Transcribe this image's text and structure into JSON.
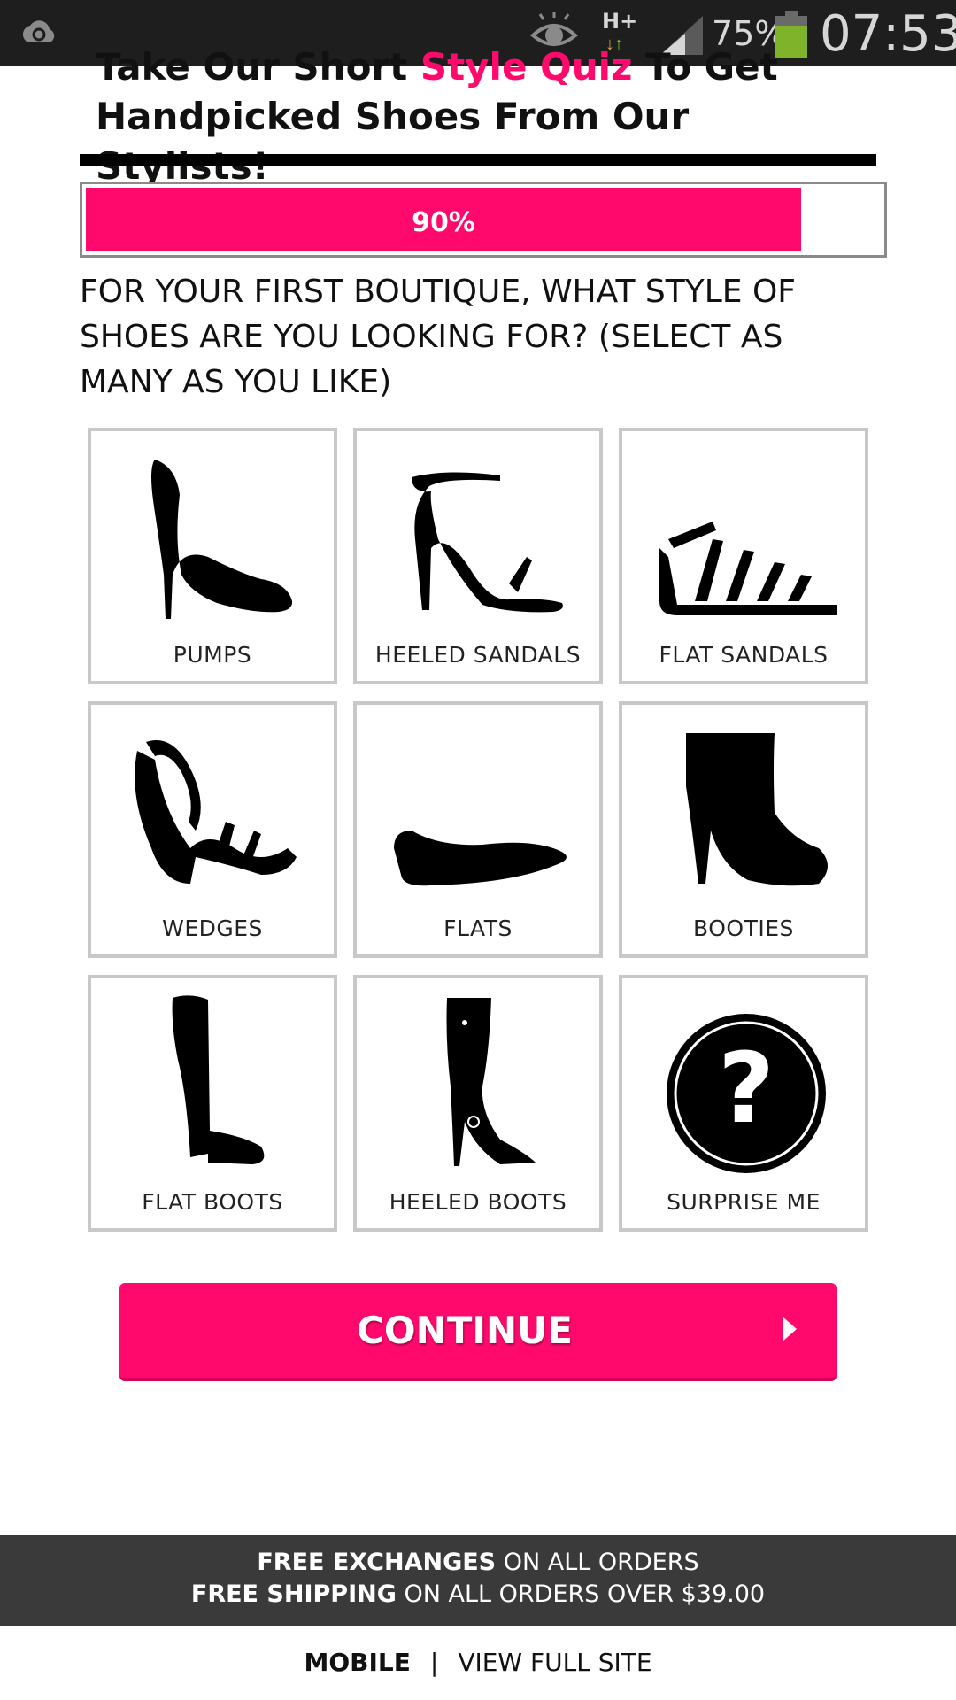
{
  "status_bar": {
    "network": "H+",
    "battery": "75%",
    "time": "07:53",
    "icons": [
      "sync-icon",
      "eye-icon",
      "data-arrows-icon",
      "signal-icon",
      "battery-icon"
    ]
  },
  "heading": {
    "line1_before": "Take Our Short ",
    "line1_highlight": "Style Quiz",
    "line1_after": " To Get",
    "line2": "Handpicked Shoes From Our Stylists!"
  },
  "progress": {
    "value": 0.9,
    "label": "90%"
  },
  "question": "FOR YOUR FIRST BOUTIQUE, WHAT STYLE OF SHOES ARE YOU LOOKING FOR? (SELECT AS MANY AS YOU LIKE)",
  "options": [
    {
      "label": "PUMPS",
      "icon": "pump-shoe-icon"
    },
    {
      "label": "HEELED SANDALS",
      "icon": "heeled-sandal-icon"
    },
    {
      "label": "FLAT SANDALS",
      "icon": "flat-sandal-icon"
    },
    {
      "label": "WEDGES",
      "icon": "wedge-shoe-icon"
    },
    {
      "label": "FLATS",
      "icon": "flat-shoe-icon"
    },
    {
      "label": "BOOTIES",
      "icon": "bootie-icon"
    },
    {
      "label": "FLAT BOOTS",
      "icon": "flat-boot-icon"
    },
    {
      "label": "HEELED BOOTS",
      "icon": "heeled-boot-icon"
    },
    {
      "label": "SURPRISE ME",
      "icon": "question-mark-icon"
    }
  ],
  "continue": {
    "label": "CONTINUE",
    "icon": "play-arrow-icon"
  },
  "promo": {
    "line1_bold": "FREE EXCHANGES",
    "line1_rest": " ON ALL ORDERS",
    "line2_bold": "FREE SHIPPING",
    "line2_rest": " ON ALL ORDERS OVER $39.00"
  },
  "footer": {
    "mobile": "MOBILE",
    "separator": "|",
    "full_site": "VIEW FULL SITE"
  },
  "colors": {
    "accent": "#ff0a6c",
    "status_bar": "#1e1e1e",
    "promo_bar": "#3a3a3a",
    "tile_border": "#c8c8c8"
  }
}
